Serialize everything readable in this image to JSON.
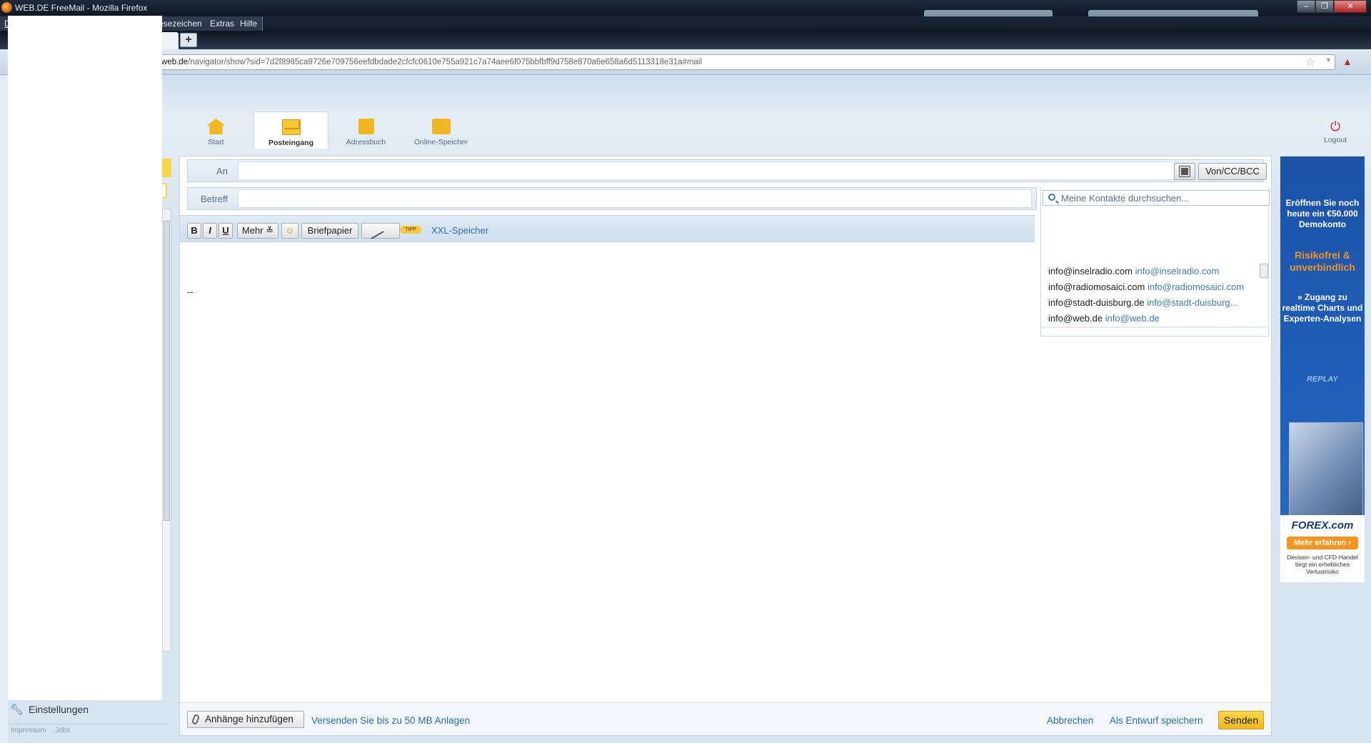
{
  "window": {
    "title": "WEB.DE FreeMail - Mozilla Firefox",
    "controls": [
      "–",
      "❐",
      "✕"
    ]
  },
  "menubar": {
    "items": [
      {
        "label": "D"
      },
      {
        "label": "esezeichen"
      },
      {
        "label": "Extras"
      },
      {
        "label": "Hilfe"
      }
    ]
  },
  "tabs": {
    "new_tab": "+"
  },
  "urlbar": {
    "host": "web.de",
    "path": "/navigator/show?sid=7d2f8985ca9726e709756eefdbdade2cfcfc0610e755a921c7a74aee6f075bbfbff9d758e870a6e658a6d5113318e31a#mail"
  },
  "appnav": {
    "items": [
      {
        "label": "Start",
        "icon": "home-icon"
      },
      {
        "label": "Posteingang",
        "icon": "mail-icon",
        "active": true
      },
      {
        "label": "Adressbuch",
        "icon": "addressbook-icon"
      },
      {
        "label": "Online-Speicher",
        "icon": "cloud-storage-icon"
      }
    ],
    "logout": "Logout"
  },
  "compose": {
    "to_label": "An",
    "subject_label": "Betreff",
    "von_cc_bcc": "Von/CC/BCC",
    "toolbar": {
      "bold": "B",
      "italic": "I",
      "underline": "U",
      "mehr": "Mehr",
      "emoji": "☺",
      "briefpapier": "Briefpapier",
      "tipp": "TIPP",
      "xxl": "XXL-Speicher"
    },
    "body_signature": "--",
    "contacts": {
      "search_placeholder": "Meine Kontakte durchsuchen...",
      "items": [
        {
          "name": "info@inselradio.com",
          "email": "info@inselradio.com"
        },
        {
          "name": "info@radiomosaici.com",
          "email": "info@radiomosaici.com"
        },
        {
          "name": "info@stadt-duisburg.de",
          "email": "info@stadt-duisburg..."
        },
        {
          "name": "info@web.de",
          "email": "info@web.de"
        }
      ]
    },
    "bottom": {
      "attach": "Anhänge hinzufügen",
      "attach_hint": "Versenden Sie bis zu 50 MB Anlagen",
      "cancel": "Abbrechen",
      "save_draft": "Als Entwurf speichern",
      "send": "Senden"
    }
  },
  "sidebar": {
    "settings": "Einstellungen",
    "footer": [
      "Impressum",
      "Jobs"
    ]
  },
  "ad": {
    "line1": "Eröffnen Sie noch heute ein €50.000 Demokonto",
    "line2": "Risikofrei & unverbindlich",
    "line3": "» Zugang zu realtime Charts und Experten-Analysen",
    "replay": "REPLAY",
    "brand": "FOREX.com",
    "more": "Mehr erfahren ›",
    "disclaimer": "Devisen- und CFD-Handel birgt ein erhebliches Verlustrisiko"
  }
}
